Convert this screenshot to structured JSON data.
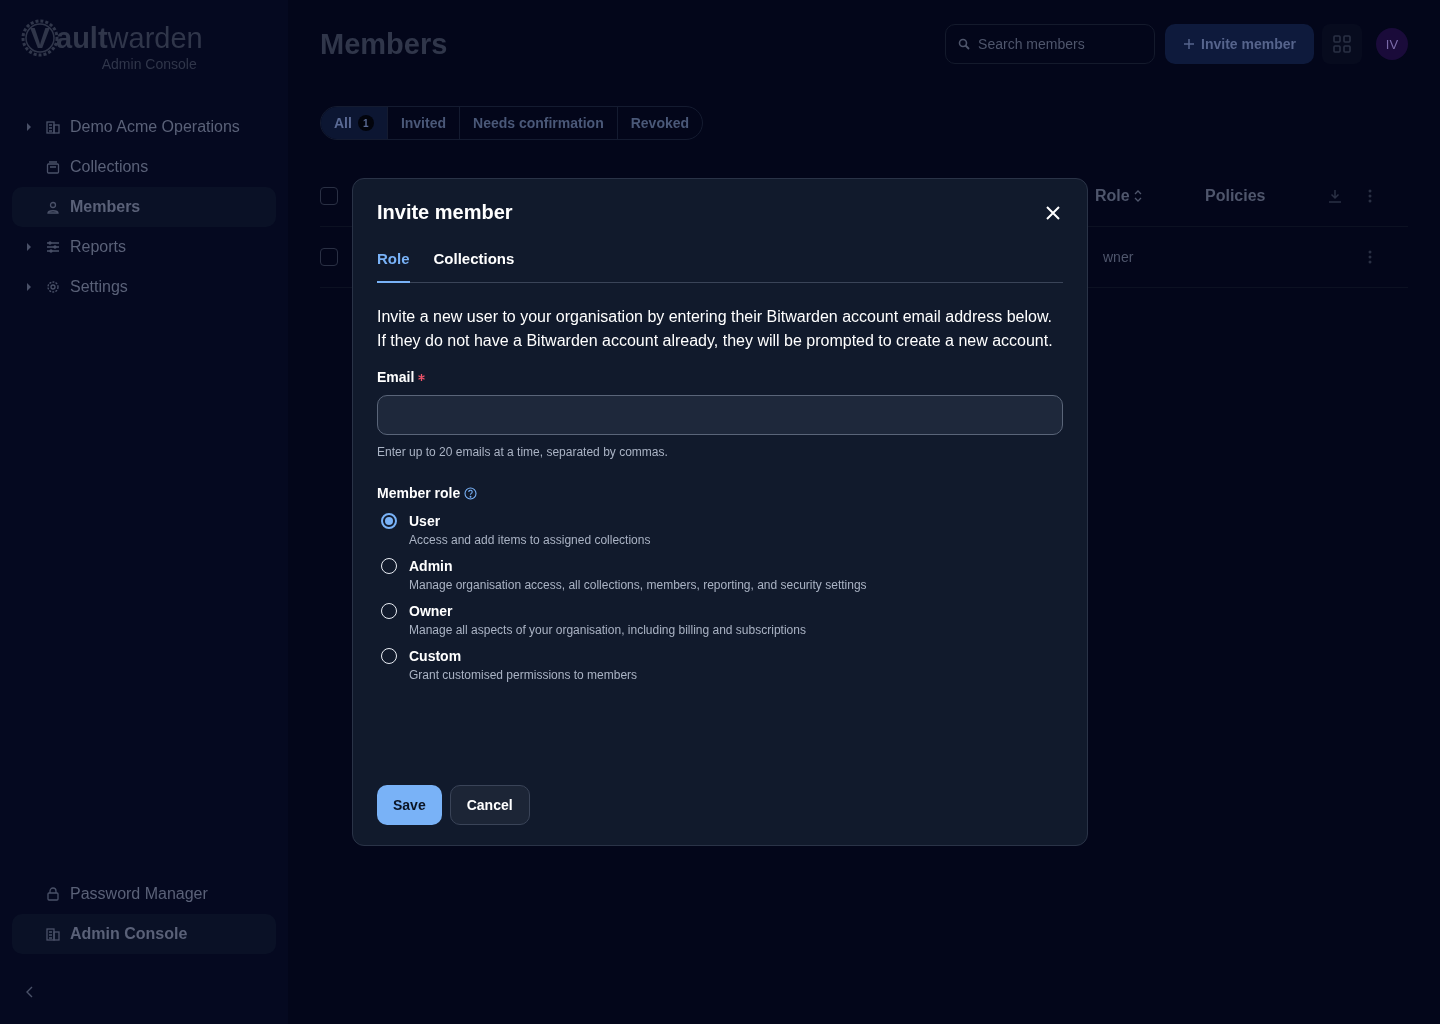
{
  "logo": {
    "mark": "V",
    "bold": "ault",
    "rest": "warden",
    "subtitle": "Admin Console"
  },
  "sidebar": {
    "items": [
      {
        "label": "Demo Acme Operations",
        "expandable": true,
        "selected": false
      },
      {
        "label": "Collections",
        "expandable": false,
        "selected": false
      },
      {
        "label": "Members",
        "expandable": false,
        "selected": true
      },
      {
        "label": "Reports",
        "expandable": true,
        "selected": false
      },
      {
        "label": "Settings",
        "expandable": true,
        "selected": false
      }
    ],
    "products": [
      {
        "label": "Password Manager",
        "selected": false
      },
      {
        "label": "Admin Console",
        "selected": true
      }
    ]
  },
  "header": {
    "title": "Members",
    "search_placeholder": "Search members",
    "invite_button": "Invite member",
    "avatar": "IV"
  },
  "filters": [
    {
      "label": "All",
      "count": "1",
      "selected": true
    },
    {
      "label": "Invited",
      "selected": false
    },
    {
      "label": "Needs confirmation",
      "selected": false
    },
    {
      "label": "Revoked",
      "selected": false
    }
  ],
  "table": {
    "select_all_checked": false,
    "columns": [
      "Role",
      "Policies"
    ],
    "rows": [
      {
        "checked": false,
        "role": "wner"
      }
    ]
  },
  "dialog": {
    "title": "Invite member",
    "tabs": [
      {
        "label": "Role",
        "selected": true
      },
      {
        "label": "Collections",
        "selected": false
      }
    ],
    "description": "Invite a new user to your organisation by entering their Bitwarden account email address below. If they do not have a Bitwarden account already, they will be prompted to create a new account.",
    "email": {
      "label": "Email",
      "required": true,
      "hint": "Enter up to 20 emails at a time, separated by commas."
    },
    "role_label": "Member role",
    "roles": [
      {
        "title": "User",
        "description": "Access and add items to assigned collections",
        "selected": true
      },
      {
        "title": "Admin",
        "description": "Manage organisation access, all collections, members, reporting, and security settings",
        "selected": false
      },
      {
        "title": "Owner",
        "description": "Manage all aspects of your organisation, including billing and subscriptions",
        "selected": false
      },
      {
        "title": "Custom",
        "description": "Grant customised permissions to members",
        "selected": false
      }
    ],
    "buttons": [
      {
        "label": "Save",
        "kind": "primary"
      },
      {
        "label": "Cancel",
        "kind": "secondary"
      }
    ]
  }
}
